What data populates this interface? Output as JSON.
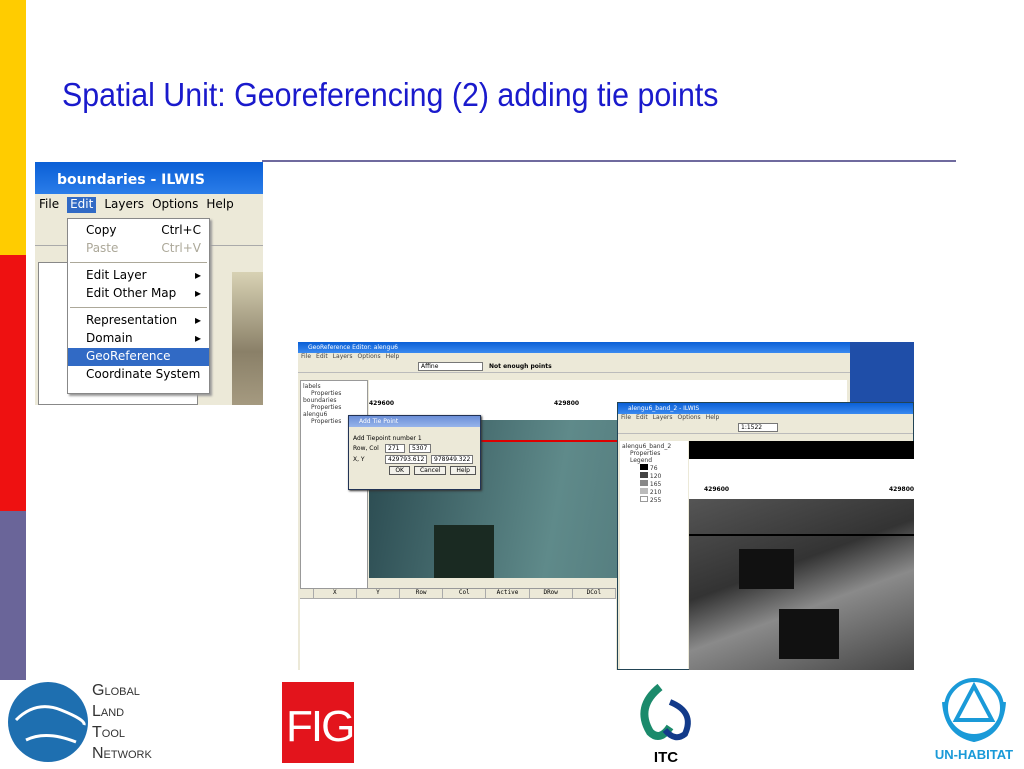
{
  "slide": {
    "title": "Spatial Unit: Georeferencing (2) adding tie points",
    "accent_colors": [
      "#ffcc00",
      "#ee1111",
      "#6a6599"
    ]
  },
  "ilwis_window": {
    "title": "boundaries - ILWIS",
    "menu": [
      "File",
      "Edit",
      "Layers",
      "Options",
      "Help"
    ],
    "edit_menu": [
      {
        "label": "Copy",
        "shortcut": "Ctrl+C"
      },
      {
        "label": "Paste",
        "shortcut": "Ctrl+V",
        "disabled": true
      },
      {
        "label": "Edit Layer",
        "submenu": true
      },
      {
        "label": "Edit Other Map",
        "submenu": true
      },
      {
        "label": "Representation",
        "submenu": true
      },
      {
        "label": "Domain",
        "submenu": true
      },
      {
        "label": "GeoReference",
        "highlighted": true
      },
      {
        "label": "Coordinate System"
      }
    ]
  },
  "georef_editor": {
    "title": "GeoReference Editor: alengu6",
    "menu": [
      "File",
      "Edit",
      "Layers",
      "Options",
      "Help"
    ],
    "transformation": "Affine",
    "status": "Not enough points",
    "layers": [
      "labels",
      "Properties",
      "boundaries",
      "Properties",
      "alengu6",
      "Properties"
    ],
    "ruler": [
      "429600",
      "429800"
    ],
    "table_columns": [
      "X",
      "Y",
      "Row",
      "Col",
      "Active",
      "DRow",
      "DCol"
    ]
  },
  "tie_point_dialog": {
    "title": "Add Tie Point",
    "prompt": "Add Tiepoint number 1",
    "rowcol_label": "Row, Col",
    "row": "271",
    "col": "5307",
    "xy_label": "X, Y",
    "x": "429793.612",
    "y": "978949.322",
    "ok": "OK",
    "cancel": "Cancel",
    "help": "Help"
  },
  "band_window": {
    "title": "alengu6_band_2 - ILWIS",
    "menu": [
      "File",
      "Edit",
      "Layers",
      "Options",
      "Help"
    ],
    "scale": "1:1522",
    "layers": [
      "alengu6_band_2",
      "Properties",
      "Legend"
    ],
    "legend": [
      "76",
      "120",
      "165",
      "210",
      "255"
    ],
    "ruler": [
      "429600",
      "429800"
    ]
  },
  "logos": {
    "gltn": [
      "Global",
      "Land",
      "Tool",
      "Network"
    ],
    "fig": "FIG",
    "itc": "ITC",
    "un_habitat": "UN-HABITAT"
  }
}
